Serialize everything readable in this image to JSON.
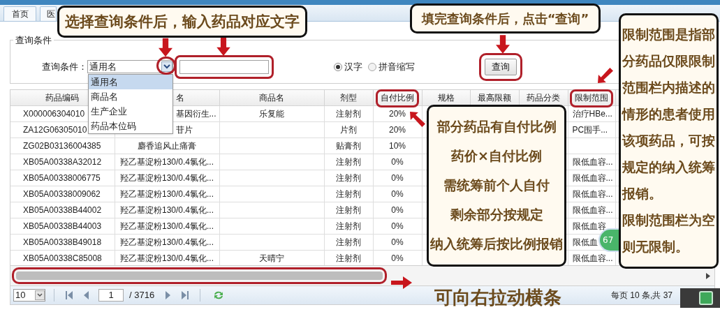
{
  "tabs": [
    {
      "label": "首页"
    },
    {
      "label": "医"
    }
  ],
  "query": {
    "legend": "查询条件",
    "label": "查询条件：",
    "select_value": "通用名",
    "options": [
      {
        "label": "通用名",
        "selected": true
      },
      {
        "label": "商品名",
        "selected": false
      },
      {
        "label": "生产企业",
        "selected": false
      },
      {
        "label": "药品本位码",
        "selected": false
      }
    ],
    "radios": [
      {
        "label": "汉字",
        "selected": true
      },
      {
        "label": "拼音缩写",
        "selected": false
      }
    ],
    "button": "查询"
  },
  "table": {
    "columns": [
      "药品编码",
      "名",
      "商品名",
      "剂型",
      "自付比例",
      "规格",
      "最高限额",
      "药品分类",
      "限制范围"
    ],
    "rows": [
      {
        "code": "X000006304010",
        "generic_name": "基因衍生...",
        "trade_name": "乐复能",
        "form": "注射剂",
        "self_pay_ratio": "20%",
        "restriction_scope": "治疗HBe..."
      },
      {
        "code": "ZA12G06305010",
        "generic_name": "苷片",
        "form": "片剂",
        "self_pay_ratio": "20%",
        "restriction_scope": "PC围手..."
      },
      {
        "code": "ZG02B03136004385",
        "generic_name": "麝香追风止痛膏",
        "form": "贴膏剂",
        "self_pay_ratio": "10%"
      },
      {
        "code": "XB05A00338A32012",
        "generic_name": "羟乙基淀粉130/0.4氯化...",
        "form": "注射剂",
        "self_pay_ratio": "0%",
        "restriction_scope": "限低血容..."
      },
      {
        "code": "XB05A00338006775",
        "generic_name": "羟乙基淀粉130/0.4氯化...",
        "form": "注射剂",
        "self_pay_ratio": "0%",
        "restriction_scope": "限低血容..."
      },
      {
        "code": "XB05A00338009062",
        "generic_name": "羟乙基淀粉130/0.4氯化...",
        "form": "注射剂",
        "self_pay_ratio": "0%",
        "restriction_scope": "限低血容..."
      },
      {
        "code": "XB05A00338B44002",
        "generic_name": "羟乙基淀粉130/0.4氯化...",
        "form": "注射剂",
        "self_pay_ratio": "0%",
        "restriction_scope": "限低血容..."
      },
      {
        "code": "XB05A00338B44003",
        "generic_name": "羟乙基淀粉130/0.4氯化...",
        "form": "注射剂",
        "self_pay_ratio": "0%",
        "restriction_scope": "限低血容"
      },
      {
        "code": "XB05A00338B49018",
        "generic_name": "羟乙基淀粉130/0.4氯化...",
        "form": "注射剂",
        "self_pay_ratio": "0%",
        "restriction_scope": "限低血"
      },
      {
        "code": "XB05A00338C85008",
        "generic_name": "羟乙基淀粉130/0.4氯化...",
        "trade_name": "天晴宁",
        "form": "注射剂",
        "self_pay_ratio": "0%",
        "restriction_scope": "限低血容..."
      }
    ]
  },
  "pager": {
    "page_size": "10",
    "page": "1",
    "total_pages": "/ 3716",
    "summary": "每页 10 条,共 37"
  },
  "floating_badge": "67",
  "annotations": [
    {
      "kind": "callout",
      "lines": [
        "选择查询条件后，输入药品对应文字"
      ]
    },
    {
      "kind": "callout",
      "lines": [
        "填完查询条件后，点击“查询”"
      ]
    },
    {
      "kind": "callout",
      "lines": [
        "部分药品有自付比例",
        "药价×自付比例",
        "需统筹前个人自付",
        "剩余部分按规定",
        "纳入统筹后按比例报销"
      ]
    },
    {
      "kind": "callout",
      "lines": [
        "限制范围是指部分药品仅限限制范围栏内描述的情形的患者使用该项药品，可按规定的纳入统筹报销。",
        "限制范围栏为空则无限制。"
      ]
    },
    {
      "kind": "caption",
      "lines": [
        "可向右拉动横条"
      ]
    }
  ]
}
